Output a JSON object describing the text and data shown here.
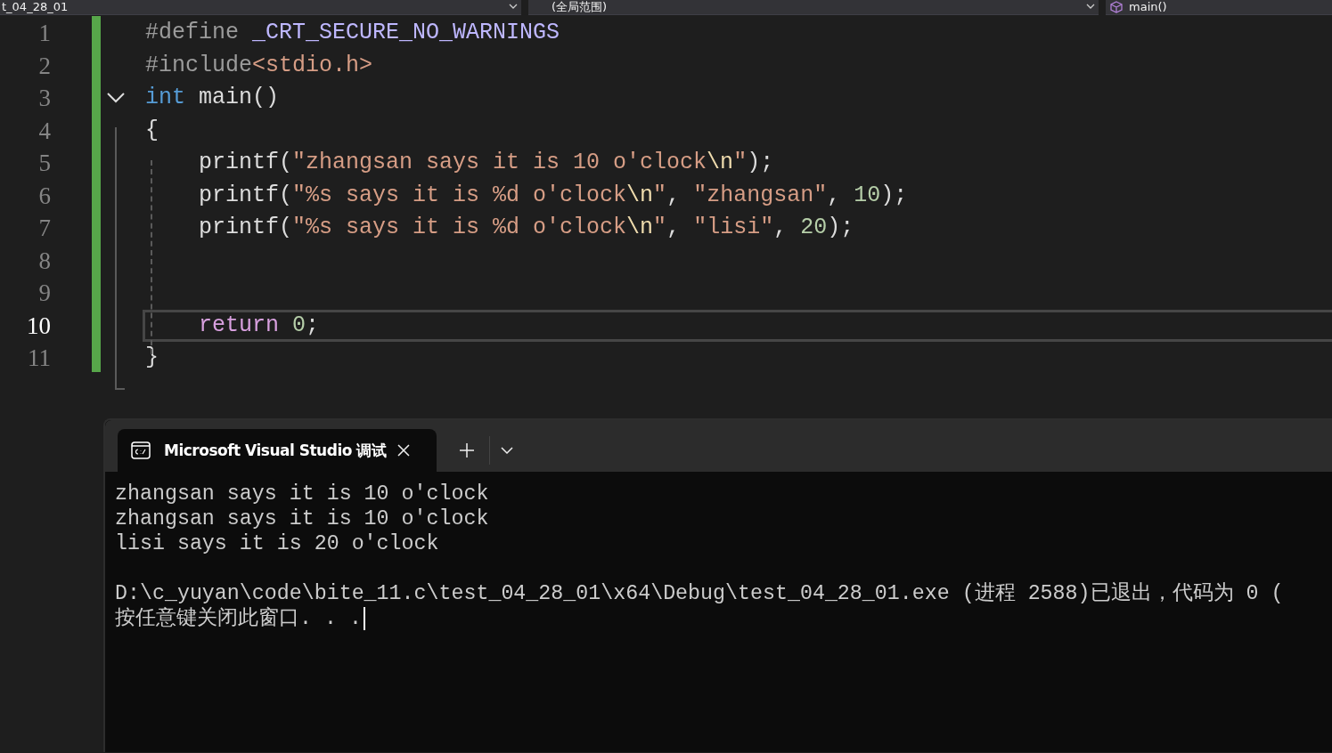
{
  "toolbar": {
    "project": "t_04_28_01",
    "scope": "(全局范围)",
    "member": "main()"
  },
  "editor": {
    "lines": [
      {
        "number": "1",
        "current": false,
        "fold": false,
        "tokens": [
          {
            "kind": "preproc",
            "text": "#define "
          },
          {
            "kind": "macro",
            "text": "_CRT_SECURE_NO_WARNINGS"
          }
        ]
      },
      {
        "number": "2",
        "current": false,
        "fold": false,
        "tokens": [
          {
            "kind": "preproc",
            "text": "#include"
          },
          {
            "kind": "string",
            "text": "<stdio.h>"
          }
        ]
      },
      {
        "number": "3",
        "current": false,
        "fold": true,
        "tokens": [
          {
            "kind": "keyword",
            "text": "int"
          },
          {
            "kind": "plain",
            "text": " main()"
          }
        ]
      },
      {
        "number": "4",
        "current": false,
        "fold": false,
        "tokens": [
          {
            "kind": "plain",
            "text": "{"
          }
        ]
      },
      {
        "number": "5",
        "current": false,
        "fold": false,
        "tokens": [
          {
            "kind": "plain",
            "text": "    printf("
          },
          {
            "kind": "string",
            "text": "\"zhangsan says it is 10 o'clock"
          },
          {
            "kind": "escape",
            "text": "\\n"
          },
          {
            "kind": "string",
            "text": "\""
          },
          {
            "kind": "plain",
            "text": ");"
          }
        ]
      },
      {
        "number": "6",
        "current": false,
        "fold": false,
        "tokens": [
          {
            "kind": "plain",
            "text": "    printf("
          },
          {
            "kind": "string",
            "text": "\"%s says it is %d o'clock"
          },
          {
            "kind": "escape",
            "text": "\\n"
          },
          {
            "kind": "string",
            "text": "\""
          },
          {
            "kind": "plain",
            "text": ", "
          },
          {
            "kind": "string",
            "text": "\"zhangsan\""
          },
          {
            "kind": "plain",
            "text": ", "
          },
          {
            "kind": "number",
            "text": "10"
          },
          {
            "kind": "plain",
            "text": ");"
          }
        ]
      },
      {
        "number": "7",
        "current": false,
        "fold": false,
        "tokens": [
          {
            "kind": "plain",
            "text": "    printf("
          },
          {
            "kind": "string",
            "text": "\"%s says it is %d o'clock"
          },
          {
            "kind": "escape",
            "text": "\\n"
          },
          {
            "kind": "string",
            "text": "\""
          },
          {
            "kind": "plain",
            "text": ", "
          },
          {
            "kind": "string",
            "text": "\"lisi\""
          },
          {
            "kind": "plain",
            "text": ", "
          },
          {
            "kind": "number",
            "text": "20"
          },
          {
            "kind": "plain",
            "text": ");"
          }
        ]
      },
      {
        "number": "8",
        "current": false,
        "fold": false
      },
      {
        "number": "9",
        "current": false,
        "fold": false
      },
      {
        "number": "10",
        "current": true,
        "fold": false,
        "tokens": [
          {
            "kind": "control",
            "text": "    return "
          },
          {
            "kind": "number",
            "text": "0"
          },
          {
            "kind": "plain",
            "text": ";"
          }
        ]
      },
      {
        "number": "11",
        "current": false,
        "fold": false,
        "tokens": [
          {
            "kind": "plain",
            "text": "}"
          }
        ]
      }
    ]
  },
  "terminal": {
    "tabs": [
      {
        "title": "Microsoft Visual Studio 调试",
        "selected": true
      }
    ],
    "output": [
      [
        "zhangsan says it is 10 o'clock",
        "zhangsan says it is 10 o'clock",
        "lisi says it is 20 o'clock"
      ],
      [
        "D:\\c_yuyan\\code\\bite_11.c\\test_04_28_01\\x64\\Debug\\test_04_28_01.exe (进程 2588)已退出，代码为 0 (",
        "按任意键关闭此窗口. . ."
      ]
    ]
  }
}
